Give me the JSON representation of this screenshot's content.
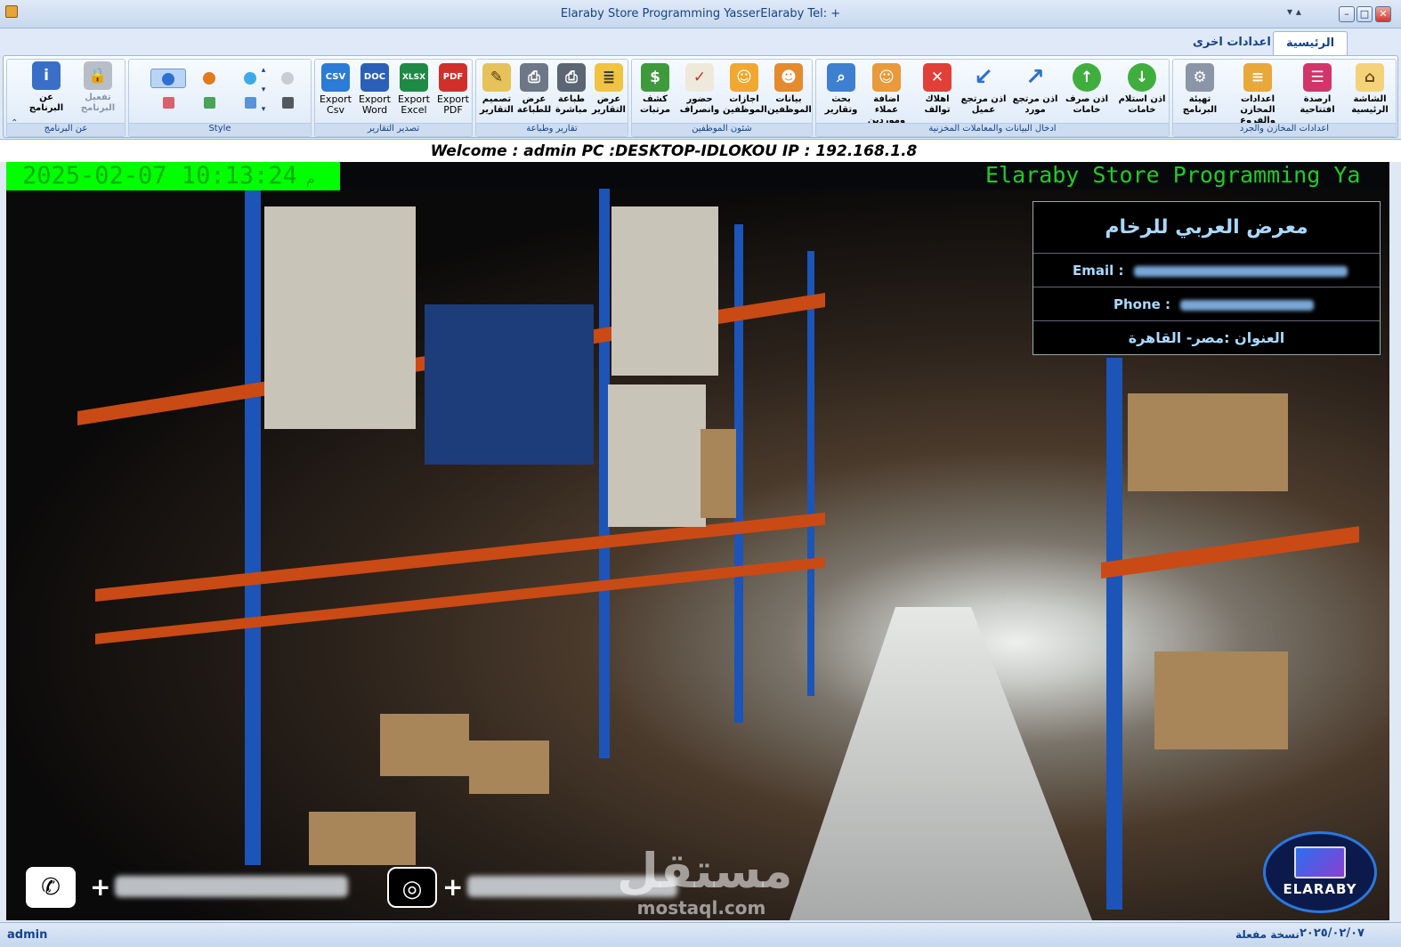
{
  "window": {
    "title": "Elaraby Store  Programming YasserElaraby  Tel: +",
    "minimize": "–",
    "maximize": "□",
    "close": "✕"
  },
  "tabs": [
    {
      "label": "الرئيسية",
      "active": true
    },
    {
      "label": "اعدادات اخرى",
      "active": false
    }
  ],
  "ribbon": {
    "groups": {
      "stores_setup": "اعدادات المخازن والجرد",
      "data_entry": "ادخال البيانات والمعاملات المخزنية",
      "employees": "شئون الموظفين",
      "reports": "تقارير وطباعة",
      "export": "تصدير التقارير",
      "style": "Style",
      "about": "عن البرنامج"
    },
    "buttons": {
      "home_screen": "الشاشة الرئيسية",
      "opening_balance": "ارصدة افتتاحية",
      "stores_settings": "اعدادات المخازن والفروع",
      "program_setup": "تهيئة البرنامج",
      "receive_raw": "اذن استلام خامات",
      "issue_raw": "اذن صرف خامات",
      "supplier_return": "اذن مرتجع مورد",
      "customer_return": "اذن مرتجع عميل",
      "damage": "اهلاك توالف",
      "add_parties": "اضافة عملاء وموردين",
      "search_reports": "بحث وتقارير",
      "employee_data": "بيانات الموظفين",
      "employee_leaves": "اجازات الموظفين",
      "attendance": "حضور وانصراف",
      "payroll": "كشف مرتبات",
      "view_reports": "عرض التقارير",
      "direct_print": "طباعة مباشرة",
      "print_preview": "عرض للطباعة",
      "design_reports": "تصميم التقارير",
      "export_pdf": "Export PDF",
      "export_excel": "Export Excel",
      "export_word": "Export Word",
      "export_csv": "Export Csv",
      "activate": "تفعيل البرنامج",
      "about": "عن البرنامج"
    },
    "icons": {
      "csv": "CSV",
      "doc": "DOC",
      "xlsx": "XLSX",
      "pdf": "PDF"
    }
  },
  "welcome": "Welcome : admin  PC :DESKTOP-IDLOKOU   IP : 192.168.1.8",
  "clock": {
    "datetime": "2025-02-07 10:13:24",
    "ampm": "م"
  },
  "marquee": "Elaraby Store   Programming Ya",
  "info": {
    "company": "معرض العربي للرخام",
    "email_label": "Email :",
    "phone_label": "Phone :",
    "address": "العنوان :مصر- القاهرة"
  },
  "contacts": {
    "phone_plus": "+",
    "whatsapp_plus": "+"
  },
  "logo": "ELARABY",
  "watermark": {
    "arabic": "مستقل",
    "latin": "mostaql.com"
  },
  "status": {
    "user": "admin",
    "license": "نسخة مفعلة",
    "date": "٢٠٢٥/٠٢/٠٧"
  },
  "colors": {
    "clock_bg": "#00ff00",
    "marquee_text": "#22cc22",
    "info_text": "#a9d9ff",
    "ribbon_text": "#15428b"
  }
}
